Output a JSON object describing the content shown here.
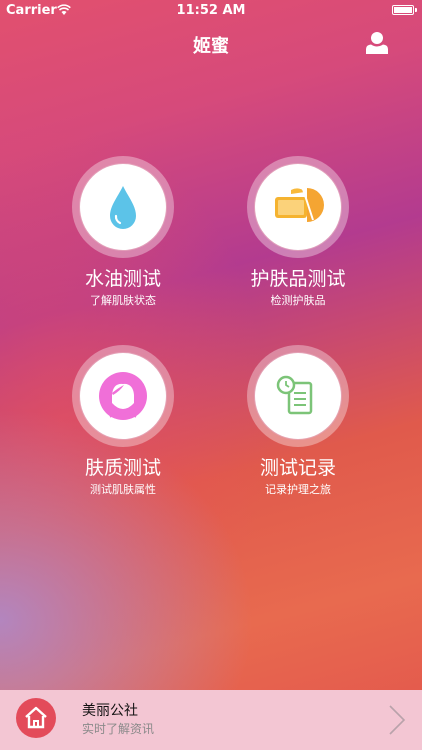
{
  "status_bar": {
    "carrier": "Carrier",
    "time": "11:52 AM"
  },
  "nav": {
    "title": "姬蜜",
    "user_icon": "user-icon"
  },
  "tiles": [
    {
      "title": "水油测试",
      "subtitle": "了解肌肤状态",
      "icon": "water-drop-icon",
      "color": "#5cc3e8"
    },
    {
      "title": "护肤品测试",
      "subtitle": "检测护肤品",
      "icon": "skincare-products-icon",
      "color": "#f5b330"
    },
    {
      "title": "肤质测试",
      "subtitle": "测试肌肤属性",
      "icon": "female-face-icon",
      "color": "#f06fd8"
    },
    {
      "title": "测试记录",
      "subtitle": "记录护理之旅",
      "icon": "record-document-icon",
      "color": "#7cc478"
    }
  ],
  "bottom": {
    "title": "美丽公社",
    "subtitle": "实时了解资讯",
    "icon": "home-icon",
    "chevron": "chevron-right-icon"
  }
}
